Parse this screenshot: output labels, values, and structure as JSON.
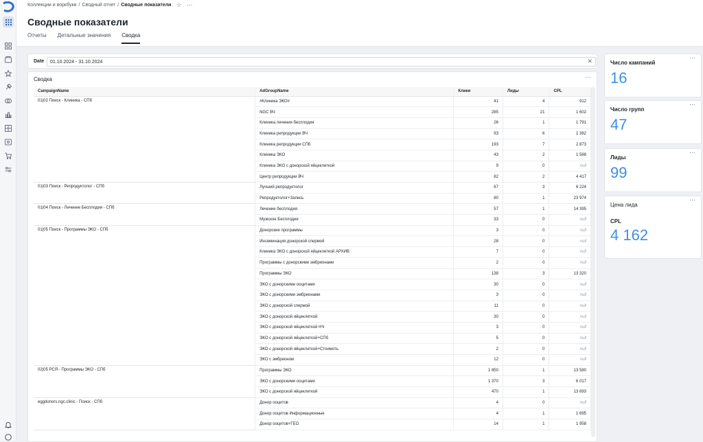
{
  "breadcrumbs": [
    "Коллекции и воркбуки",
    "Сводный отчет",
    "Сводные показатели"
  ],
  "page_title": "Сводные показатели",
  "tabs": [
    {
      "label": "Отчеты",
      "active": false
    },
    {
      "label": "Детальные значения",
      "active": false
    },
    {
      "label": "Сводка",
      "active": true
    }
  ],
  "date_filter": {
    "label": "Date",
    "value": "01.10.2024 - 31.10.2024"
  },
  "table_card": {
    "title": "Сводка",
    "columns": [
      "CampaignName",
      "AdGroupName",
      "Клики",
      "Лиды",
      "CPL"
    ],
    "groups": [
      {
        "campaign": "01|02 Поиск - Клиника - СПб",
        "rows": [
          [
            "#Клиника ЭКО#",
            "41",
            "4",
            "912"
          ],
          [
            "NGC ВЧ",
            "285",
            "21",
            "1 602"
          ],
          [
            "Клиника лечения бесплодия",
            "26",
            "1",
            "1 791"
          ],
          [
            "Клиника репродукции ВЧ",
            "93",
            "6",
            "1 382"
          ],
          [
            "Клиника репродукции СПб",
            "193",
            "7",
            "2 873"
          ],
          [
            "Клиника ЭКО",
            "43",
            "2",
            "1 588"
          ],
          [
            "Клиника ЭКО с донорской яйцеклеткой",
            "9",
            "0",
            "null"
          ],
          [
            "Центр репродукции ВЧ",
            "82",
            "2",
            "4 417"
          ]
        ]
      },
      {
        "campaign": "01|03 Поиск - Репродуктолог - СПб",
        "rows": [
          [
            "Лучший репродуктолог",
            "67",
            "3",
            "6 224"
          ],
          [
            "Репродуктолог+Запись",
            "80",
            "1",
            "23 974"
          ]
        ]
      },
      {
        "campaign": "01|04 Поиск - Лечение Бесплодия - СПб",
        "rows": [
          [
            "Лечение бесплодия",
            "57",
            "1",
            "14 395"
          ],
          [
            "Мужское Бесплодие",
            "33",
            "0",
            "null"
          ]
        ]
      },
      {
        "campaign": "01|05 Поиск - Программы ЭКО - СПб",
        "rows": [
          [
            "Донорские программы",
            "3",
            "0",
            "null"
          ],
          [
            "Инсеминация донорской спермой",
            "28",
            "0",
            "null"
          ],
          [
            "Клиника ЭКО с донорской яйцеклеткой АРХИВ",
            "7",
            "0",
            "null"
          ],
          [
            "Программы с донорскими эмбрионами",
            "2",
            "0",
            "null"
          ],
          [
            "Программы ЭКО",
            "138",
            "3",
            "13 320"
          ],
          [
            "ЭКО с донорскими ооцитами",
            "30",
            "0",
            "null"
          ],
          [
            "ЭКО с донорскими эмбрионами",
            "3",
            "0",
            "null"
          ],
          [
            "ЭКО с донорской спермой",
            "11",
            "0",
            "null"
          ],
          [
            "ЭКО с донорской яйцеклеткой",
            "30",
            "0",
            "null"
          ],
          [
            "ЭКО с донорской яйцеклеткой НЧ",
            "3",
            "0",
            "null"
          ],
          [
            "ЭКО с донорской яйцеклеткой+СПб",
            "5",
            "0",
            "null"
          ],
          [
            "ЭКО с донорской яйцеклеткой+Стоимоть",
            "2",
            "0",
            "null"
          ],
          [
            "ЭКО с эмбрионом",
            "12",
            "0",
            "null"
          ]
        ]
      },
      {
        "campaign": "02|05 РСЯ - Программы ЭКО - СПб",
        "rows": [
          [
            "Программы ЭКО",
            "1 850",
            "1",
            "13 580"
          ],
          [
            "ЭКО с донорскими ооцитами",
            "1 370",
            "3",
            "6 017"
          ],
          [
            "ЭКО с донорской яйцеклеткой",
            "470",
            "1",
            "13 693"
          ]
        ]
      },
      {
        "campaign": "eggdonors.ngc.clinic - Поиск - СПб",
        "rows": [
          [
            "Донор ооцитов",
            "4",
            "0",
            "null"
          ],
          [
            "Донор ооцитов Информационные",
            "4",
            "1",
            "1 695"
          ],
          [
            "Донор ооцитов+ГЕО",
            "14",
            "1",
            "1 958"
          ]
        ]
      }
    ]
  },
  "kpis": [
    {
      "title": "Число кампаний",
      "value": "16"
    },
    {
      "title": "Число групп",
      "value": "47"
    },
    {
      "title": "Лиды",
      "value": "99"
    },
    {
      "title": "Цена лида",
      "subtitle": "CPL",
      "value": "4 162"
    }
  ],
  "colors": {
    "accent": "#3d8fe0",
    "nav_active": "#d8e2f3"
  },
  "icons": [
    "logo-icon",
    "apps-grid-icon",
    "dashboard-icon",
    "collections-icon",
    "star-icon",
    "pin-icon",
    "connections-icon",
    "charts-icon",
    "datasets-icon",
    "reports-icon",
    "cart-icon",
    "settings-icon",
    "bell-icon",
    "help-icon",
    "ellipsis-icon",
    "close-icon"
  ]
}
